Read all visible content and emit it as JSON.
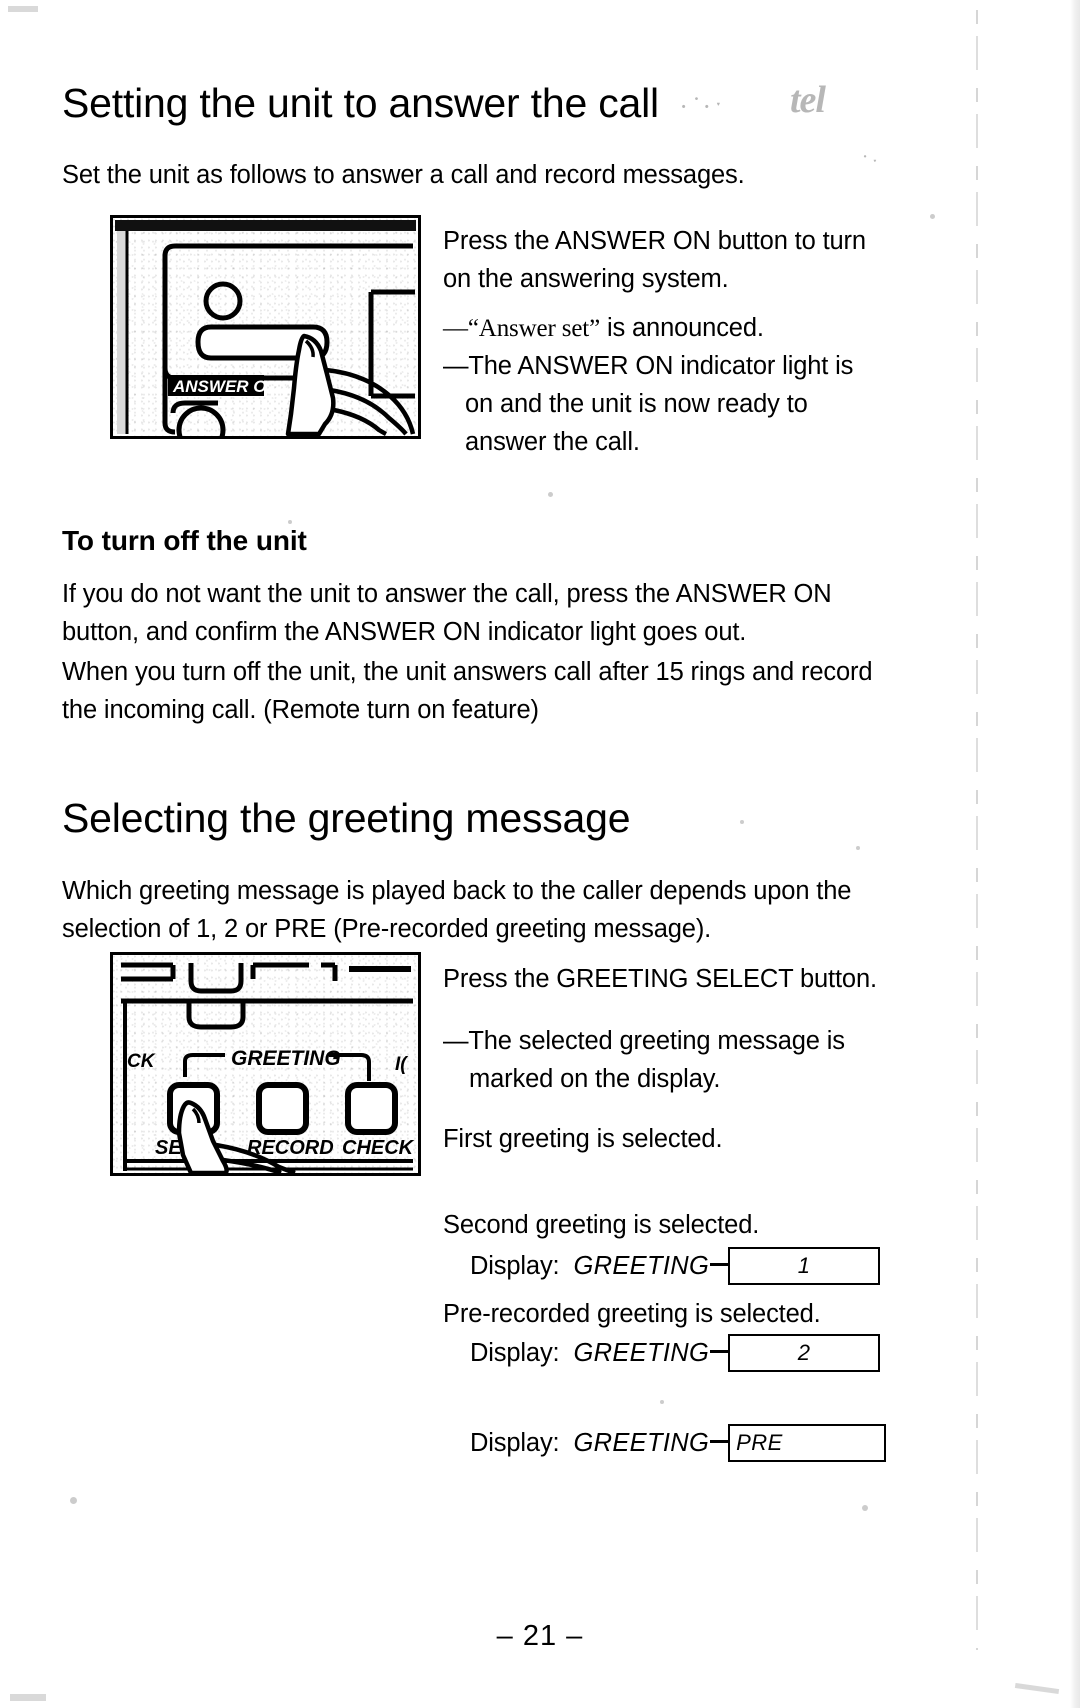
{
  "page": {
    "number_label": "– 21 –",
    "header_smudge": "tel"
  },
  "sections": [
    {
      "id": "answer",
      "heading": "Setting the unit to answer the call",
      "intro": "Set the unit as follows to answer a call and record messages.",
      "illustration": {
        "name": "answer-on-button-illustration",
        "button_badge": "ANSWER O",
        "alt": "Finger pressing the ANSWER ON button on the unit panel"
      },
      "steps": [
        "Press the ANSWER ON button to turn on the answering system.",
        "—“Answer set” is announced.",
        "—The ANSWER ON indicator light is on and the unit is now ready to answer the call."
      ],
      "step1": "Press the ANSWER ON button to turn",
      "step1b": "on the answering system.",
      "bullet1_quote": "—“Answer set”",
      "bullet1_rest": " is announced.",
      "bullet2a": "—The ANSWER ON indicator light is",
      "bullet2b": "on and the unit is now ready to",
      "bullet2c": "answer the call.",
      "subheading": "To turn off the unit",
      "body1a": "If you do not want the unit to answer the call, press the ANSWER ON",
      "body1b": "button, and confirm the ANSWER ON indicator light goes out.",
      "body2a": "When you turn off the unit, the unit answers call after 15 rings and record",
      "body2b": "the incoming call. (Remote turn on feature)"
    },
    {
      "id": "greeting",
      "heading": "Selecting the greeting message",
      "intro_a": "Which greeting message is played back to the caller depends upon the",
      "intro_b": "selection of 1, 2 or PRE (Pre-recorded greeting message).",
      "illustration": {
        "name": "greeting-select-button-illustration",
        "label_left_partial": "CK",
        "label_group": "GREETING",
        "label_right_partial": "I(",
        "button_labels": [
          "SELE",
          "RECORD",
          "CHECK"
        ],
        "alt": "Finger pressing the GREETING SELECT button on the unit panel"
      },
      "step1": "Press the GREETING SELECT button.",
      "bullet1a": "—The selected greeting message is",
      "bullet1b": "marked on the display.",
      "displays": [
        {
          "caption": "First greeting is selected.",
          "label": "Display:",
          "greeting_word": "GREETING",
          "value": "1",
          "align": "center"
        },
        {
          "caption": "Second greeting is selected.",
          "label": "Display:",
          "greeting_word": "GREETING",
          "value": "2",
          "align": "center"
        },
        {
          "caption": "Pre-recorded greeting is selected.",
          "label": "Display:",
          "greeting_word": "GREETING",
          "value": "PRE",
          "align": "left"
        }
      ]
    }
  ]
}
